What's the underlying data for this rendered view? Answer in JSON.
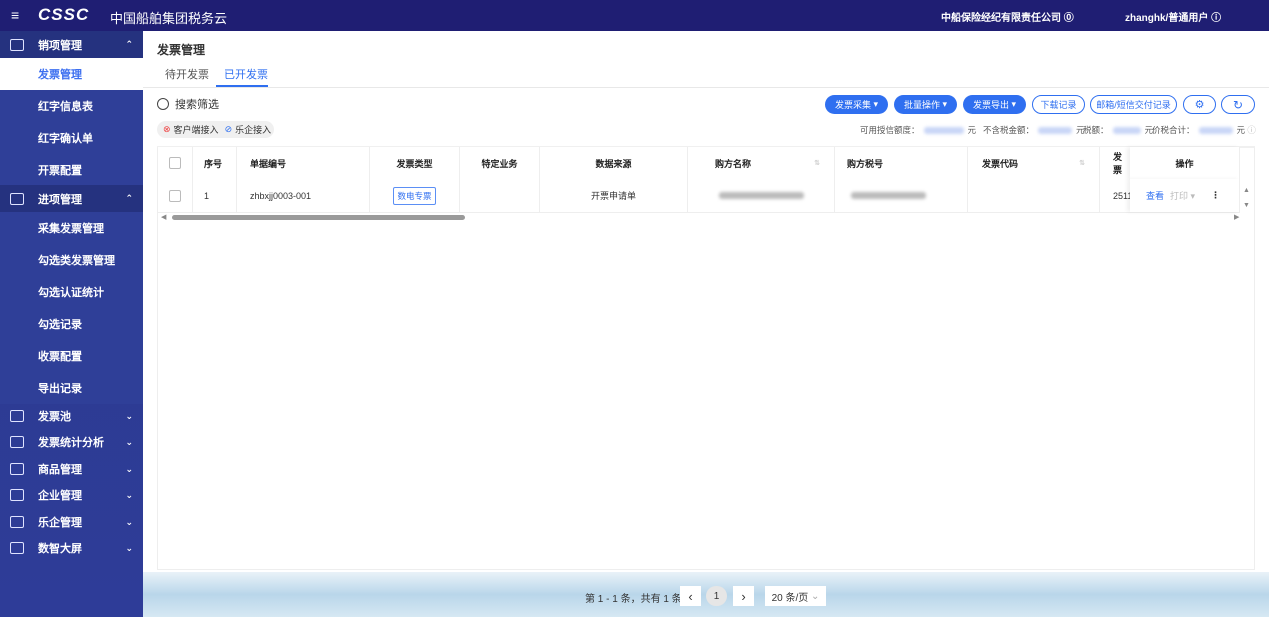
{
  "header": {
    "logo": "CSSC",
    "app_title": "中国船舶集团税务云",
    "company": "中船保险经纪有限责任公司",
    "user": "zhanghk/普通用户"
  },
  "sidebar": {
    "groups": [
      {
        "label": "销项管理",
        "items": [
          "发票管理",
          "红字信息表",
          "红字确认单",
          "开票配置"
        ]
      },
      {
        "label": "进项管理",
        "items": [
          "采集发票管理",
          "勾选类发票管理",
          "勾选认证统计",
          "勾选记录",
          "收票配置",
          "导出记录"
        ]
      }
    ],
    "collapsed": [
      "发票池",
      "发票统计分析",
      "商品管理",
      "企业管理",
      "乐企管理",
      "数智大屏"
    ],
    "active": "发票管理"
  },
  "page": {
    "title": "发票管理",
    "tabs": [
      "待开发票",
      "已开发票"
    ],
    "active_tab": "已开发票",
    "search_label": "搜索筛选",
    "chips": [
      "客户端接入",
      "乐企接入"
    ]
  },
  "toolbar": {
    "collect": "发票采集",
    "batch": "批量操作",
    "export": "发票导出",
    "download_log": "下载记录",
    "delivery_log": "邮箱/短信交付记录"
  },
  "summary": {
    "credit": "可用授信额度：",
    "untaxed": "不含税金额：",
    "tax": "税额：",
    "total": "价税合计：",
    "unit": "元"
  },
  "table": {
    "headers": [
      "序号",
      "单据编号",
      "发票类型",
      "特定业务",
      "数据来源",
      "购方名称",
      "购方税号",
      "发票代码",
      "发票",
      "操作"
    ],
    "rows": [
      {
        "index": "1",
        "doc_no": "zhbxjj0003-001",
        "type": "数电专票",
        "special": "",
        "source": "开票申请单",
        "invoice_no_partial": "2511",
        "view": "查看",
        "print": "打印"
      }
    ]
  },
  "pagination": {
    "summary": "第 1 - 1 条，共有 1 条",
    "page": "1",
    "page_size": "20 条/页"
  },
  "colors": {
    "topbar": "#1f1e73",
    "sidebar": "#2d3a8f",
    "accent": "#2f6ff0"
  }
}
